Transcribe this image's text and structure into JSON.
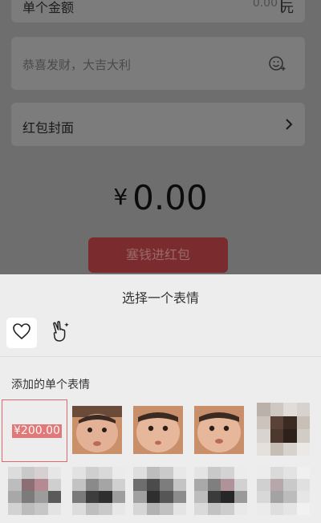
{
  "amount_row": {
    "label": "单个金额",
    "value": "0.00",
    "unit": "元"
  },
  "message": {
    "placeholder": "恭喜发财，大吉大利",
    "emoji_icon": "smiley-plus-icon"
  },
  "cover": {
    "label": "红包封面",
    "arrow_icon": "chevron-right-icon"
  },
  "total": {
    "currency": "¥",
    "amount": "0.00"
  },
  "send_button": "塞钱进红包",
  "sheet": {
    "title": "选择一个表情",
    "tabs": [
      {
        "icon": "heart-icon",
        "selected": true
      },
      {
        "icon": "peace-hand-icon",
        "selected": false
      }
    ],
    "section_label": "添加的单个表情",
    "selected_sticker_text": "¥200.00",
    "accent_color": "#e06a6a"
  }
}
